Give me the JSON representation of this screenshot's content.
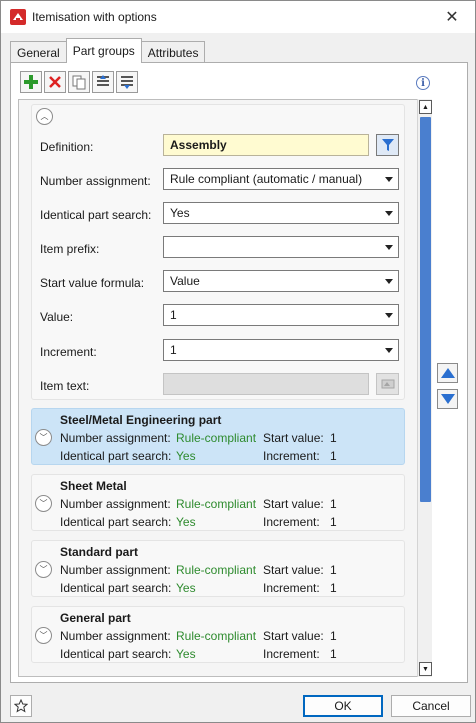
{
  "window": {
    "title": "Itemisation with options",
    "close_glyph": "✕"
  },
  "tabs": [
    {
      "label": "General",
      "active": false
    },
    {
      "label": "Part groups",
      "active": true
    },
    {
      "label": "Attributes",
      "active": false
    }
  ],
  "toolbar": {
    "icons": [
      "add-icon",
      "delete-icon",
      "copy-icon",
      "move-up-icon",
      "move-down-icon"
    ],
    "info_glyph": "i"
  },
  "definition": {
    "label": "Definition:",
    "value": "Assembly",
    "fields": [
      {
        "label": "Number assignment:",
        "value": "Rule compliant (automatic / manual)"
      },
      {
        "label": "Identical part search:",
        "value": "Yes"
      },
      {
        "label": "Item prefix:",
        "value": ""
      },
      {
        "label": "Start value formula:",
        "value": "Value"
      },
      {
        "label": "Value:",
        "value": "1"
      },
      {
        "label": "Increment:",
        "value": "1"
      },
      {
        "label": "Item text:",
        "value": ""
      }
    ]
  },
  "groups": [
    {
      "name": "Steel/Metal Engineering part",
      "number_assignment_label": "Number assignment:",
      "number_assignment": "Rule-compliant",
      "start_value_label": "Start value:",
      "start_value": "1",
      "identical_label": "Identical part search:",
      "identical": "Yes",
      "increment_label": "Increment:",
      "increment": "1"
    },
    {
      "name": "Sheet Metal",
      "number_assignment_label": "Number assignment:",
      "number_assignment": "Rule-compliant",
      "start_value_label": "Start value:",
      "start_value": "1",
      "identical_label": "Identical part search:",
      "identical": "Yes",
      "increment_label": "Increment:",
      "increment": "1"
    },
    {
      "name": "Standard part",
      "number_assignment_label": "Number assignment:",
      "number_assignment": "Rule-compliant",
      "start_value_label": "Start value:",
      "start_value": "1",
      "identical_label": "Identical part search:",
      "identical": "Yes",
      "increment_label": "Increment:",
      "increment": "1"
    },
    {
      "name": "General part",
      "number_assignment_label": "Number assignment:",
      "number_assignment": "Rule-compliant",
      "start_value_label": "Start value:",
      "start_value": "1",
      "identical_label": "Identical part search:",
      "identical": "Yes",
      "increment_label": "Increment:",
      "increment": "1"
    }
  ],
  "footer": {
    "ok_label": "OK",
    "cancel_label": "Cancel"
  },
  "colors": {
    "accent": "#0067c0",
    "selected_row": "#cce4f7",
    "rule_text": "#2e8b2e",
    "definition_bg": "#fffbd1"
  }
}
